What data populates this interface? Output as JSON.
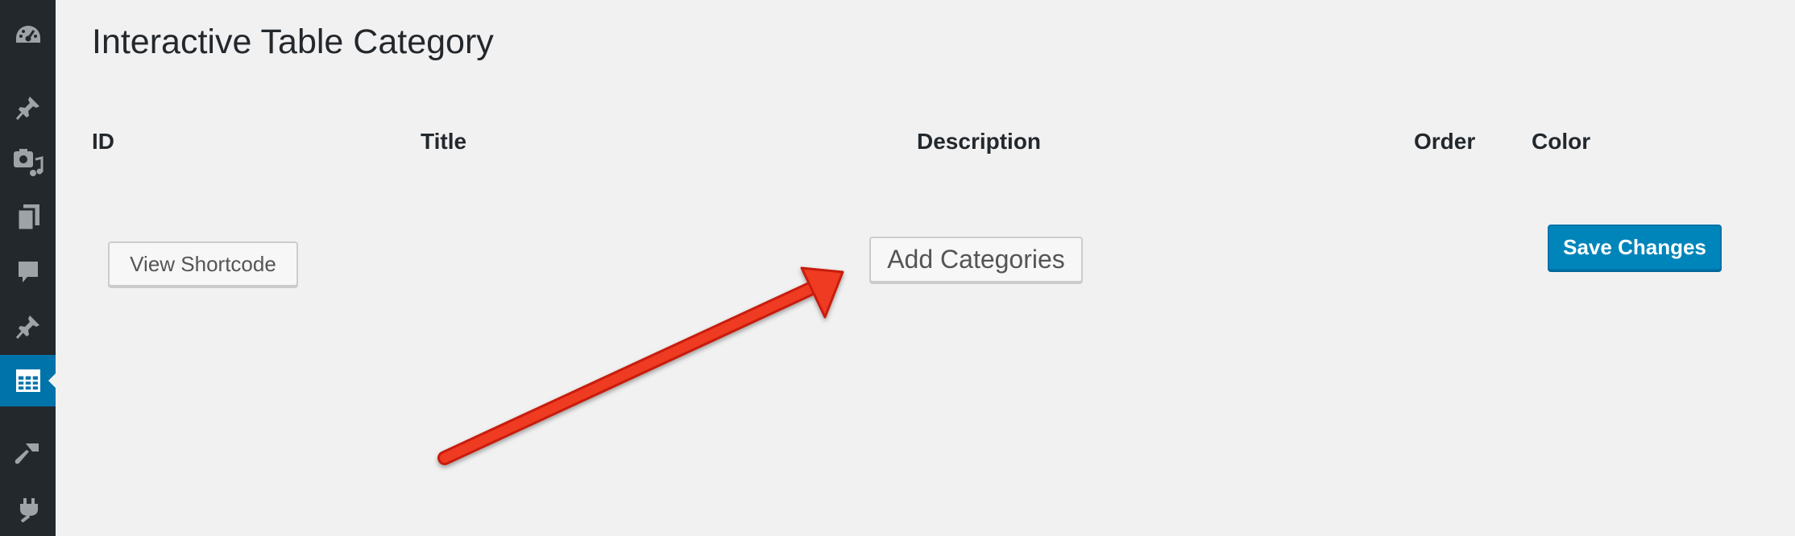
{
  "sidebar": {
    "items": [
      {
        "icon": "dashboard-icon"
      },
      {
        "icon": "pin-icon"
      },
      {
        "icon": "media-icon"
      },
      {
        "icon": "pages-icon"
      },
      {
        "icon": "comments-icon"
      },
      {
        "icon": "pin-icon"
      },
      {
        "icon": "table-icon",
        "active": true
      },
      {
        "icon": "appearance-brush-icon"
      },
      {
        "icon": "plugins-icon"
      }
    ]
  },
  "page": {
    "title": "Interactive Table Category"
  },
  "table": {
    "columns": [
      "ID",
      "Title",
      "Description",
      "Order",
      "Color"
    ]
  },
  "actions": {
    "view_shortcode": "View Shortcode",
    "add_categories": "Add Categories",
    "save_changes": "Save Changes"
  },
  "colors": {
    "sidebar_bg": "#23282d",
    "active_menu": "#0073aa",
    "primary_button": "#0085ba",
    "annotation_arrow": "#e8321c"
  }
}
